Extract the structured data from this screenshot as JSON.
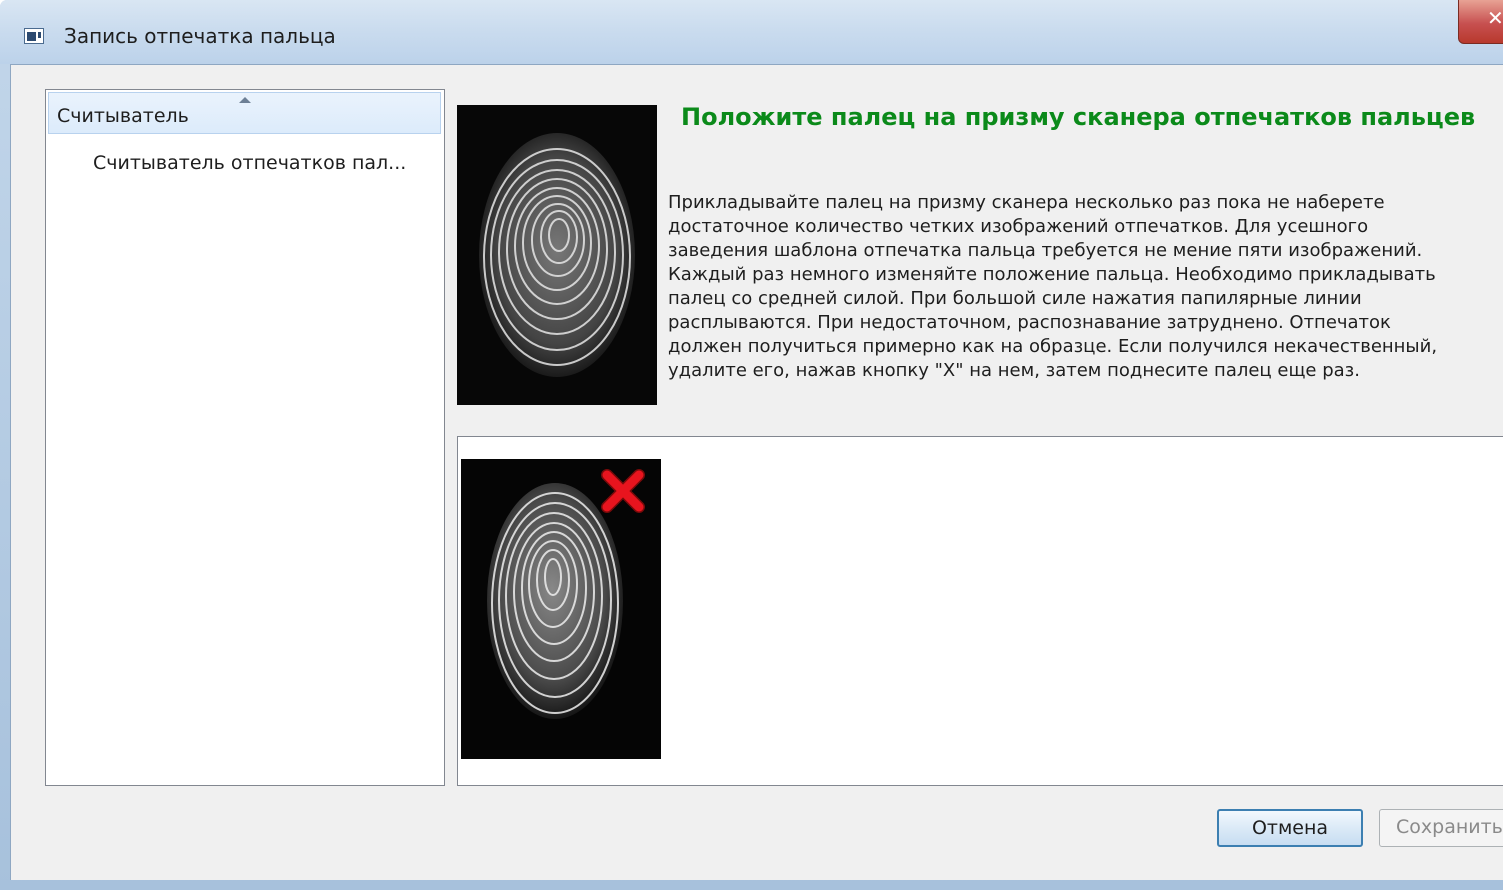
{
  "window": {
    "title": "Запись отпечатка пальца",
    "close_glyph": "✕"
  },
  "left_panel": {
    "group_header": "Считыватель",
    "items": [
      {
        "label": "Считыватель отпечатков пал..."
      }
    ]
  },
  "main": {
    "sample_image_icon": "fingerprint-sample-image",
    "heading": "Положите палец на призму сканера отпечатков пальцев",
    "instructions": [
      "Прикладывайте палец на призму сканера несколько раз пока не наберете",
      "достаточное количество четких изображений отпечатков. Для усешного",
      "заведения шаблона отпечатка пальца требуется не мение пяти изображений.",
      "Каждый раз немного изменяйте положение пальца. Необходимо прикладывать",
      "палец со средней силой. При большой силе нажатия папилярные линии",
      "расплываются. При недостаточном, распознавание затруднено. Отпечаток",
      "должен получиться примерно как на образце. Если получился некачественный,",
      "удалите его, нажав кнопку \"X\" на нем, затем поднесите палец еще раз."
    ],
    "captures": [
      {
        "image_icon": "captured-fingerprint-image",
        "delete_icon": "delete-x-icon"
      }
    ]
  },
  "buttons": {
    "cancel": "Отмена",
    "save": "Сохранить"
  },
  "colors": {
    "heading": "#0b8a1a",
    "delete_x": "#e8141e",
    "window_frame": "#b9cfe6"
  }
}
